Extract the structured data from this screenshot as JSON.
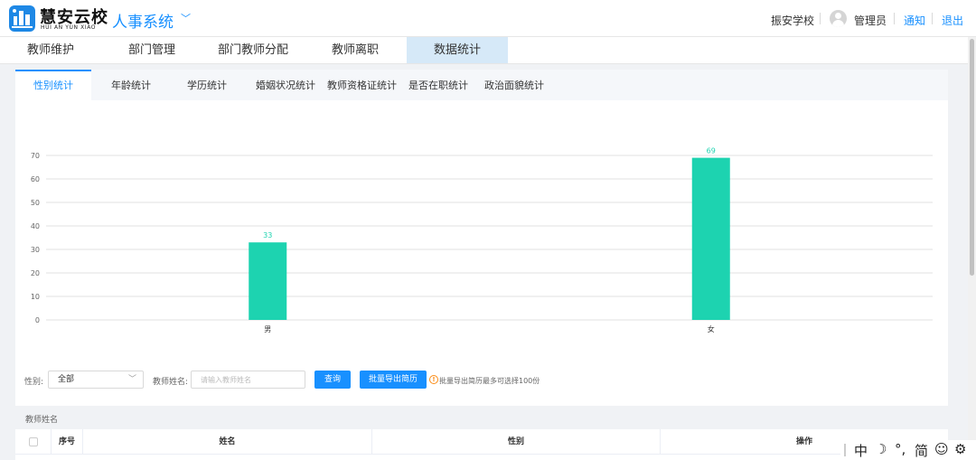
{
  "header": {
    "logo_cn": "慧安云校",
    "logo_en": "HUI AN YUN XIAO",
    "system_title": "人事系统",
    "school": "振安学校",
    "user": "管理员",
    "notice": "通知",
    "logout": "退出"
  },
  "main_nav": [
    "教师维护",
    "部门管理",
    "部门教师分配",
    "教师离职",
    "数据统计"
  ],
  "sub_tabs": [
    "性别统计",
    "年龄统计",
    "学历统计",
    "婚姻状况统计",
    "教师资格证统计",
    "是否在职统计",
    "政治面貌统计"
  ],
  "chart_data": {
    "type": "bar",
    "categories": [
      "男",
      "女"
    ],
    "values": [
      33,
      69
    ],
    "y_ticks": [
      0,
      10,
      20,
      30,
      40,
      50,
      60,
      70
    ],
    "ylim": [
      0,
      70
    ],
    "grid": true,
    "bar_color": "#1dd3b0",
    "label_color": "#1dd3b0"
  },
  "filters": {
    "gender_label": "性别:",
    "gender_value": "全部",
    "name_label": "教师姓名:",
    "name_placeholder": "请输入教师姓名",
    "query_button": "查询",
    "export_button": "批量导出简历",
    "hint": "批量导出简历最多可选择100份"
  },
  "list_label": "教师姓名",
  "table": {
    "columns": [
      "序号",
      "姓名",
      "性别",
      "操作"
    ]
  },
  "ime": {
    "keys": [
      "中",
      "☽",
      "°,",
      "简",
      "☺",
      "⚙"
    ]
  },
  "colors": {
    "accent": "#1890ff",
    "active_tab_bg": "#d6e9f8",
    "bar": "#1dd3b0"
  }
}
